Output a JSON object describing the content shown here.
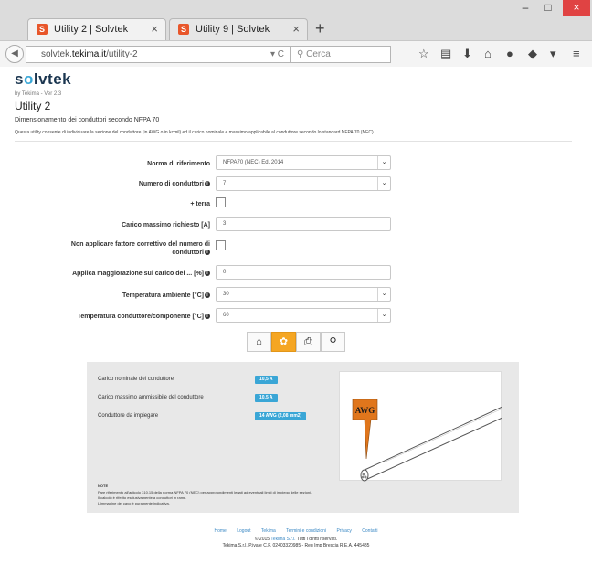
{
  "browser": {
    "tabs": [
      {
        "title": "Utility 2 | Solvtek",
        "favicon": "S"
      },
      {
        "title": "Utility 9 | Solvtek",
        "favicon": "S"
      }
    ],
    "new_tab": "+",
    "close_tab": "×",
    "url_prefix": "solvtek.",
    "url_domain": "tekima.it",
    "url_path": "/utility-2",
    "search_placeholder": "Cerca",
    "window_min": "–",
    "window_max": "□",
    "window_close": "×"
  },
  "header": {
    "logo_pre": "s",
    "logo_o": "o",
    "logo_post": "lvtek",
    "tagline": "by Tekima - Ver 2.3"
  },
  "main": {
    "title": "Utility 2",
    "subtitle": "Dimensionamento dei conduttori secondo NFPA 70",
    "description": "Questa utility consente di individuare la sezione del conduttore (in AWG o in kcmil) ed il carico nominale e massimo applicabile al conduttore secondo lo standard NFPA 70 (NEC)."
  },
  "form": {
    "norma_label": "Norma di riferimento",
    "norma_value": "NFPA70 (NEC) Ed. 2014",
    "numero_label": "Numero di conduttori",
    "numero_value": "7",
    "terra_label": "+ terra",
    "carico_label": "Carico massimo richiesto [A]",
    "carico_value": "3",
    "fattore_label_1": "Non applicare fattore correttivo del numero di",
    "fattore_label_2": "conduttori",
    "maggiorazione_label": "Applica maggiorazione sul carico del ... [%]",
    "maggiorazione_value": "0",
    "temp_amb_label": "Temperatura ambiente [°C]",
    "temp_amb_value": "30",
    "temp_cond_label": "Temperatura conduttore/componente [°C]",
    "temp_cond_value": "60"
  },
  "toolbar": {
    "home_icon": "⌂",
    "settings_icon": "✿",
    "print_icon": "⎙",
    "search_icon": "⚲"
  },
  "results": {
    "nominal_label": "Carico nominale del conduttore",
    "nominal_value": "10,5 A",
    "max_label": "Carico massimo ammissibile del conduttore",
    "max_value": "10,5 A",
    "conductor_label": "Conduttore da impiegare",
    "conductor_value": "14 AWG (2,08 mm2)",
    "awg_tag": "AWG",
    "note_title": "NOTE",
    "note_1": "Fare riferimento all'articolo 310.15 della norma NFPA 70 (NEC) per approfondimenti legati ad eventuali limiti di impiego delle sezioni.",
    "note_2": "Il calcolo è riferito esclusivamente a conduttori in rame.",
    "note_3": "L'immagine del cavo è puramente indicativa."
  },
  "footer": {
    "links": [
      "Home",
      "Logout",
      "Tekima",
      "Termini e condizioni",
      "Privacy",
      "Contatti"
    ],
    "copy_pre": "© 2015 ",
    "copy_link": "Tekima S.r.l.",
    "copy_post": " Tutti i diritti riservati.",
    "company": "Tekima S.r.l. P.iva e C.F. 02403320985 - Reg Imp Brescia R.E.A. 445485"
  },
  "colors": {
    "accent": "#f5a623",
    "badge": "#3aa6d6",
    "brand": "#1b3650",
    "awg_tag": "#e0761c"
  }
}
